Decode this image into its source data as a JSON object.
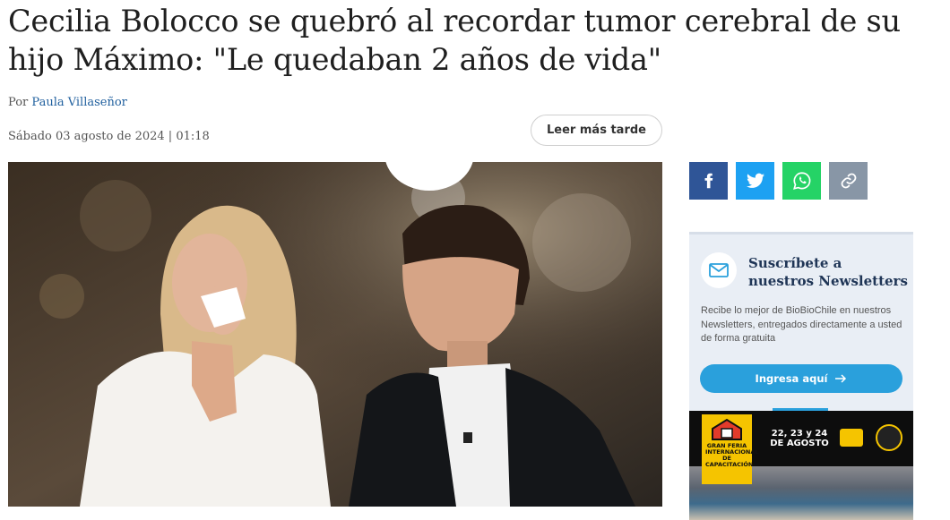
{
  "article": {
    "headline_line1": "Cecilia Bolocco se quebró al recordar tumor cerebral de su",
    "headline_line2": "hijo Máximo: \"Le quedaban 2 años de vida\"",
    "byline_prefix": "Por",
    "author": "Paula Villaseñor",
    "date": "Sábado 03 agosto de 2024 | 01:18",
    "read_later_label": "Leer más tarde"
  },
  "share": {
    "icons": [
      "facebook-icon",
      "twitter-icon",
      "whatsapp-icon",
      "link-icon"
    ],
    "colors": {
      "facebook": "#2f5597",
      "twitter": "#1da1f2",
      "whatsapp": "#25d366",
      "link": "#8896a6"
    }
  },
  "newsletter": {
    "title": "Suscríbete a nuestros Newsletters",
    "description": "Recibe lo mejor de BioBioChile en nuestros Newsletters, entregados directamente a usted de forma gratuita",
    "button_label": "Ingresa aquí",
    "button_icon": "arrow-right-icon",
    "accent": "#2aa0dc"
  },
  "ad": {
    "dates": "22, 23 y 24\nDE AGOSTO",
    "feria_text": "GRAN FERIA INTERNACIONAL DE CAPACITACIÓN"
  }
}
